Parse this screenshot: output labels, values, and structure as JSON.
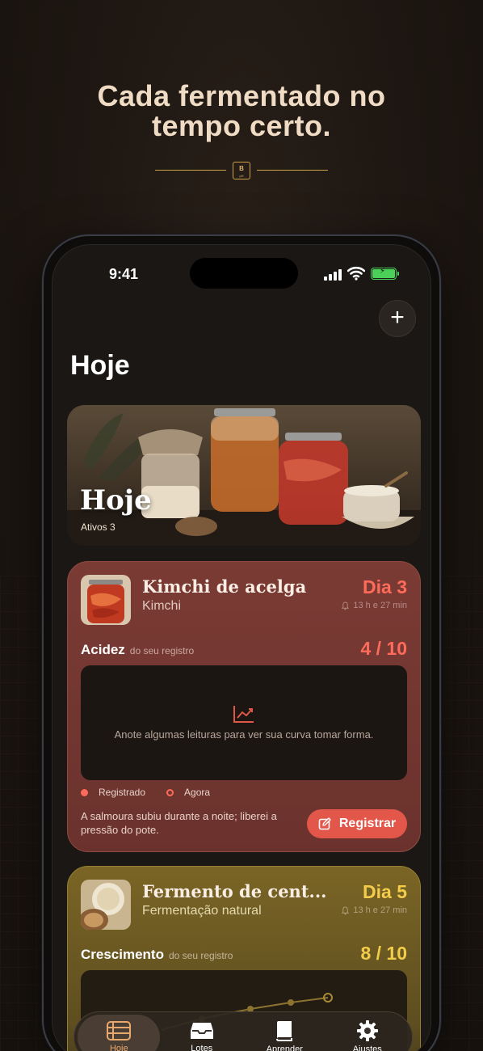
{
  "marketing": {
    "headline_line1": "Cada fermentado no",
    "headline_line2": "tempo certo.",
    "badge_top": "B",
    "badge_bottom": "pH"
  },
  "status_bar": {
    "time": "9:41"
  },
  "header": {
    "title": "Hoje",
    "add_icon": "plus-icon"
  },
  "hero": {
    "title": "Hoje",
    "subtitle": "Ativos  3"
  },
  "cards": [
    {
      "name": "Kimchi de acelga",
      "type": "Kimchi",
      "day": "Dia 3",
      "remaining": "13 h e 27 min",
      "metric_label": "Acidez",
      "metric_source": "do seu registro",
      "metric_value": "4 / 10",
      "empty_chart_text": "Anote algumas leituras para ver sua curva tomar forma.",
      "legend_recorded": "Registrado",
      "legend_now": "Agora",
      "note": "A salmoura subiu durante a noite; liberei a pressão do pote.",
      "register_label": "Registrar",
      "accent": "#ff6b5a"
    },
    {
      "name": "Fermento de cent...",
      "type": "Fermentação natural",
      "day": "Dia 5",
      "remaining": "13 h e 27 min",
      "metric_label": "Crescimento",
      "metric_source": "do seu registro",
      "metric_value": "8 / 10",
      "accent": "#f3cc4a"
    }
  ],
  "tabbar": {
    "items": [
      {
        "label": "Hoje",
        "icon": "list-icon",
        "active": true
      },
      {
        "label": "Lotes",
        "icon": "inbox-icon",
        "active": false
      },
      {
        "label": "Aprender",
        "icon": "book-icon",
        "active": false
      },
      {
        "label": "Ajustes",
        "icon": "gear-icon",
        "active": false
      }
    ]
  },
  "colors": {
    "background": "#1e1712",
    "card_red": "#7a3b34",
    "card_gold": "#7a6525",
    "accent_red": "#ff6b5a",
    "accent_gold": "#f3cc4a",
    "tab_active": "#e9a86d"
  }
}
